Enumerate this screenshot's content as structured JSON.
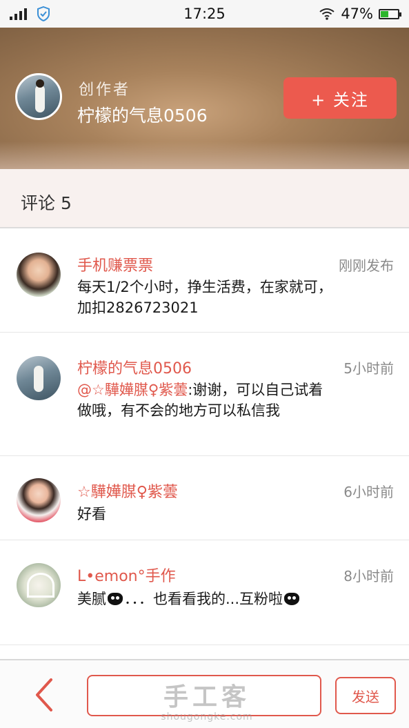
{
  "status_bar": {
    "time": "17:25",
    "battery": "47%",
    "battery_level": 0.47
  },
  "header": {
    "role": "创作者",
    "name": "柠檬的气息0506",
    "follow_label": "+ 关注"
  },
  "comment_section": {
    "title": "评论 5"
  },
  "comments": [
    {
      "author": "手机赚票票",
      "time": "刚刚发布",
      "text": "每天1/2个小时，挣生活费，在家就可，加扣2826723021"
    },
    {
      "author": "柠檬的气息0506",
      "time": "5小时前",
      "mention": "@☆驊嬅腜♀紫蕓",
      "text": ":谢谢，可以自己试着做哦，有不会的地方可以私信我"
    },
    {
      "author": "☆驊嬅腜♀紫蕓",
      "time": "6小时前",
      "text": "好看"
    },
    {
      "author": "L•emon°手作",
      "time": "8小时前",
      "text_before": "美腻",
      "text_after": "．．．也看看我的...互粉啦"
    }
  ],
  "bottom_bar": {
    "input_placeholder": "",
    "send_label": "发送",
    "watermark_main": "手工客",
    "watermark_sub": "shougongke.com"
  },
  "colors": {
    "accent": "#ec5a4e",
    "author_red": "#e0584c"
  }
}
